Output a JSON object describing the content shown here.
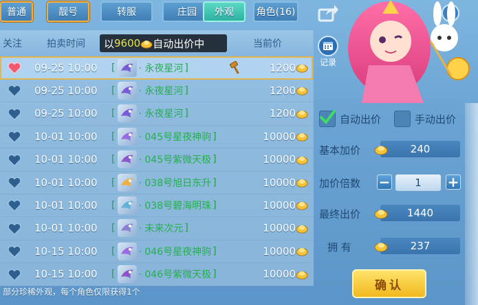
{
  "tabs": [
    {
      "label": "普通",
      "highlighted": true,
      "active": false
    },
    {
      "label": "靓号",
      "highlighted": true,
      "active": false
    },
    {
      "label": "转服",
      "highlighted": false,
      "active": false
    },
    {
      "label": "庄园",
      "highlighted": false,
      "active": false
    },
    {
      "label": "外观",
      "highlighted": false,
      "active": true
    },
    {
      "label": "角色(16)",
      "highlighted": false,
      "active": false
    }
  ],
  "header": {
    "col_follow": "关注",
    "col_time": "拍卖时间",
    "banner_prefix": "以",
    "banner_amount": "9600",
    "banner_suffix": "自动出价中",
    "col_price": "当前价"
  },
  "rows": [
    {
      "time": "09-25 10:00",
      "item": "永夜星河",
      "price": "1200",
      "liked": true
    },
    {
      "time": "09-25 10:00",
      "item": "永夜星河",
      "price": "1200",
      "liked": false
    },
    {
      "time": "09-25 10:00",
      "item": "永夜星河",
      "price": "1200",
      "liked": false
    },
    {
      "time": "10-01 10:00",
      "item": "045号星夜神驹",
      "price": "10000",
      "liked": false
    },
    {
      "time": "10-01 10:00",
      "item": "045号紫微天极",
      "price": "10000",
      "liked": false
    },
    {
      "time": "10-01 10:00",
      "item": "038号旭日东升",
      "price": "10000",
      "liked": false
    },
    {
      "time": "10-01 10:00",
      "item": "038号碧海明珠",
      "price": "10000",
      "liked": false
    },
    {
      "time": "10-01 10:00",
      "item": "未来次元",
      "price": "10000",
      "liked": false
    },
    {
      "time": "10-15 10:00",
      "item": "046号星夜神驹",
      "price": "10000",
      "liked": false
    },
    {
      "time": "10-15 10:00",
      "item": "046号紫微天极",
      "price": "10000",
      "liked": false
    }
  ],
  "footer_note": "部分珍稀外观，每个角色仅限获得1个",
  "panel": {
    "record_label": "记录",
    "auto_bid_label": "自动出价",
    "auto_bid_checked": true,
    "manual_bid_label": "手动出价",
    "manual_bid_checked": false,
    "base_increment_label": "基本加价",
    "base_increment_value": "240",
    "multiplier_label": "加价倍数",
    "multiplier_value": "1",
    "final_bid_label": "最终出价",
    "final_bid_value": "1440",
    "owned_label": "拥  有",
    "owned_value": "237",
    "confirm_label": "确认"
  },
  "colors": {
    "item_green": "#22b14c",
    "banner_gold": "#e8e34a",
    "confirm_gold": "#f1b81d"
  }
}
